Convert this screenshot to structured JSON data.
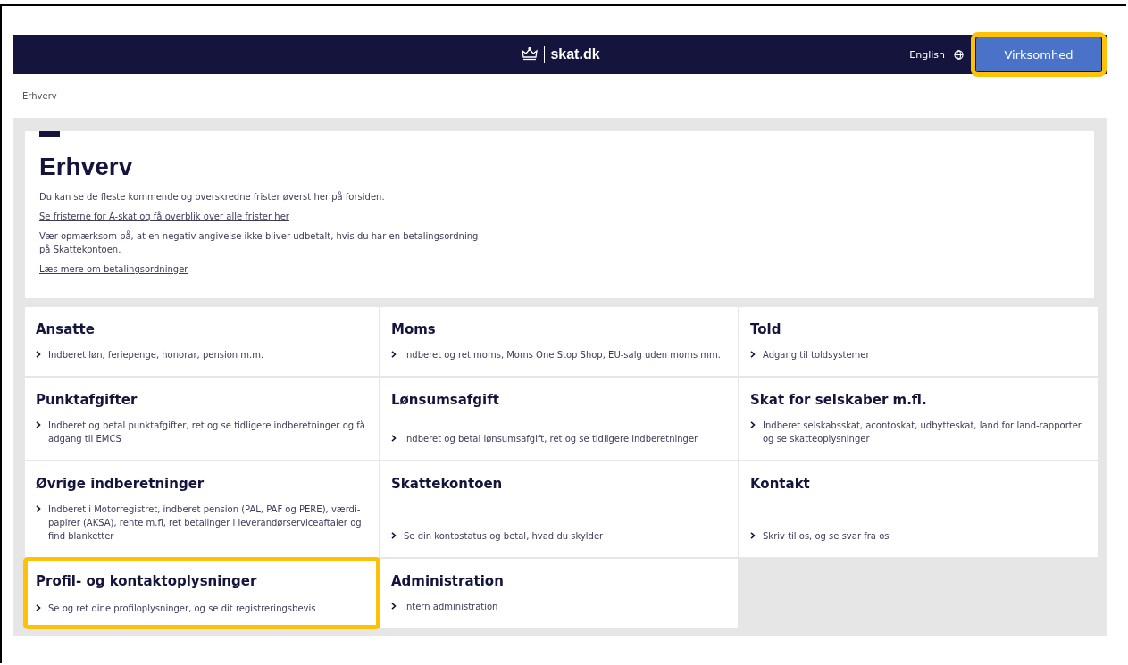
{
  "header": {
    "logo_text": "skat.dk",
    "language": "English",
    "nav_button": {
      "label": "Virksomhed",
      "highlighted": true
    }
  },
  "breadcrumb": "Erhverv",
  "intro": {
    "title": "Erhverv",
    "paragraphs": [
      {
        "kind": "text",
        "text": "Du kan se de fleste kommende og overskredne frister øverst her på forsiden."
      },
      {
        "kind": "link",
        "text": "Se fristerne for A-skat og få overblik over alle frister her"
      },
      {
        "kind": "text",
        "text": "Vær opmærksom på, at en negativ angivelse ikke bliver udbetalt, hvis du har en betalingsordning på Skattekontoen."
      },
      {
        "kind": "link",
        "text": "Læs mere om betalingsordninger"
      }
    ]
  },
  "tiles": [
    {
      "title": "Ansatte",
      "link": "Indberet løn, feriepenge, honorar, pension m.m.",
      "highlighted": false
    },
    {
      "title": "Moms",
      "link": "Indberet og ret moms, Moms One Stop Shop, EU-salg uden moms mm.",
      "highlighted": false
    },
    {
      "title": "Told",
      "link": "Adgang til toldsystemer",
      "highlighted": false
    },
    {
      "title": "Punktafgifter",
      "link": "Indberet og betal punktafgifter, ret og se tidligere indberetninger og få adgang til EMCS",
      "highlighted": false
    },
    {
      "title": "Lønsumsafgift",
      "link": "Indberet og betal lønsumsafgift, ret og se tidligere indberetninger",
      "highlighted": false
    },
    {
      "title": "Skat for selskaber m.fl.",
      "link": "Indberet selskabsskat, acontoskat, udbytteskat, land for land-rapporter og se skatteoplysninger",
      "highlighted": false
    },
    {
      "title": "Øvrige indberetninger",
      "link": "Indberet i Motorregistret, indberet pension (PAL, PAF og PERE), værdi-papirer (AKSA), rente m.fl, ret betalinger i leverandørserviceaftaler og find blanketter",
      "highlighted": false
    },
    {
      "title": "Skattekontoen",
      "link": "Se din kontostatus og betal, hvad du skylder",
      "highlighted": false
    },
    {
      "title": "Kontakt",
      "link": "Skriv til os, og se svar fra os",
      "highlighted": false
    },
    {
      "title": "Profil- og kontaktoplysninger",
      "link": "Se og ret dine profiloplysninger, og se dit registreringsbevis",
      "highlighted": true
    },
    {
      "title": "Administration",
      "link": "Intern administration",
      "highlighted": false
    }
  ]
}
